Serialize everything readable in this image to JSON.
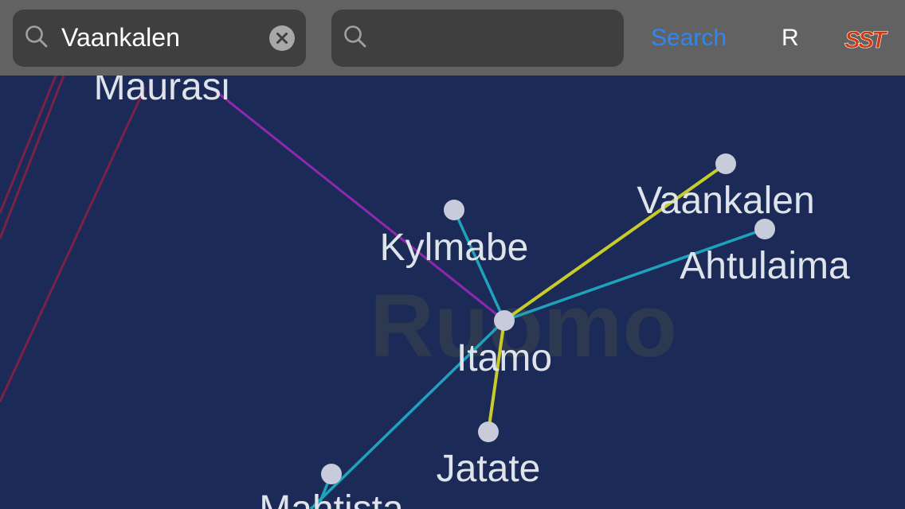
{
  "toolbar": {
    "from_search": {
      "value": "Vaankalen",
      "icon": "search-icon",
      "clear_icon": "clear-icon"
    },
    "to_search": {
      "value": "",
      "placeholder": "",
      "icon": "search-icon"
    },
    "search_label": "Search",
    "r_label": "R",
    "logo_text": "SST"
  },
  "map": {
    "region_label": "Ruomo",
    "stations": {
      "maurasi": "Maurasi",
      "kylmabe": "Kylmabe",
      "vaankalen": "Vaankalen",
      "ahtulaima": "Ahtulaima",
      "itamo": "Itamo",
      "jatate": "Jatate",
      "mahtista": "Mahtista"
    },
    "colors": {
      "background": "#1b2a56",
      "red_line": "#7a2146",
      "purple_line": "#8f28b0",
      "teal_line": "#1fa3bd",
      "yellow_line": "#c8cc2a",
      "accent_blue": "#2f86f2"
    }
  }
}
